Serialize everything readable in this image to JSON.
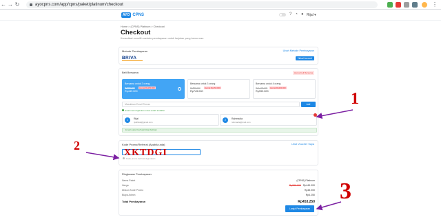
{
  "browser": {
    "url": "ayocpns.com/app/cpns/paket/platinum/checkout"
  },
  "header": {
    "logo_badge": "AYO",
    "logo_text": "CPNS",
    "user_label": "Rijal"
  },
  "page": {
    "breadcrumb": "Home  >  (CPNS) Platinum  >  Checkout",
    "title": "Checkout",
    "subtitle": "Konsultasi memilih metode pembayaran untuk lanjutan yang kamu mau"
  },
  "payment_method": {
    "title": "Metode Pembayaran",
    "change_link": "Ubah Metode Pembayaran",
    "selected": "BRIVA",
    "badge": "Virtual Account"
  },
  "group_buy": {
    "title": "Beli Bersama",
    "badge": "Hemat beli Bersama",
    "packages": [
      {
        "name": "Bersama untuk 2 orang",
        "old_price": "Rp599.000",
        "discount": "Hemat Rp150.000",
        "price": "Rp449.000"
      },
      {
        "name": "Bersama untuk 3 orang",
        "old_price": "Rp899.000",
        "discount": "Hemat Rp150.000",
        "price": "Rp749.000"
      },
      {
        "name": "Bersama untuk 4 orang",
        "old_price": "Rp1.199.000",
        "discount": "Hemat Rp200.000",
        "price": "Rp999.000"
      }
    ],
    "email_placeholder": "Masukkan Email Teman",
    "add_button": "Add",
    "email_note": "Email memungkinkan untuk sudah terdaftar",
    "members": [
      {
        "num": "1",
        "name": "Rijal",
        "email": "rijalhikal@gmail.com"
      },
      {
        "num": "2",
        "name": "Rahmadia",
        "email": "rahmadia@mail.com"
      }
    ],
    "success_note": "Email sudah berhasil ditambahkan"
  },
  "promo": {
    "title": "Kode Promo/Referral (Apabila ada)",
    "link": "Lihat Voucher Saya",
    "code_overlay": "XKTDGI",
    "note": "Kode promo berhasil digunakan"
  },
  "summary": {
    "title": "Ringkasan Pembayaran",
    "rows": [
      {
        "label": "Nama Paket",
        "value": "(CPNS) Platinum",
        "strike": ""
      },
      {
        "label": "Harga",
        "value": "Rp449.000",
        "strike": "Rp599.000"
      },
      {
        "label": "Diskon Kode Promo",
        "value": "Rp45.000",
        "strike": ""
      },
      {
        "label": "Biaya Admin",
        "value": "Rp4.250",
        "strike": ""
      }
    ],
    "total_label": "Total Pembayaran",
    "total_value": "Rp453.250",
    "pay_button": "Lanjut Pembayaran"
  },
  "annotations": [
    "1",
    "2",
    "3"
  ],
  "colors": {
    "primary": "#1e88e5",
    "annotation": "#d00000",
    "arrow": "#7b1fa2"
  }
}
